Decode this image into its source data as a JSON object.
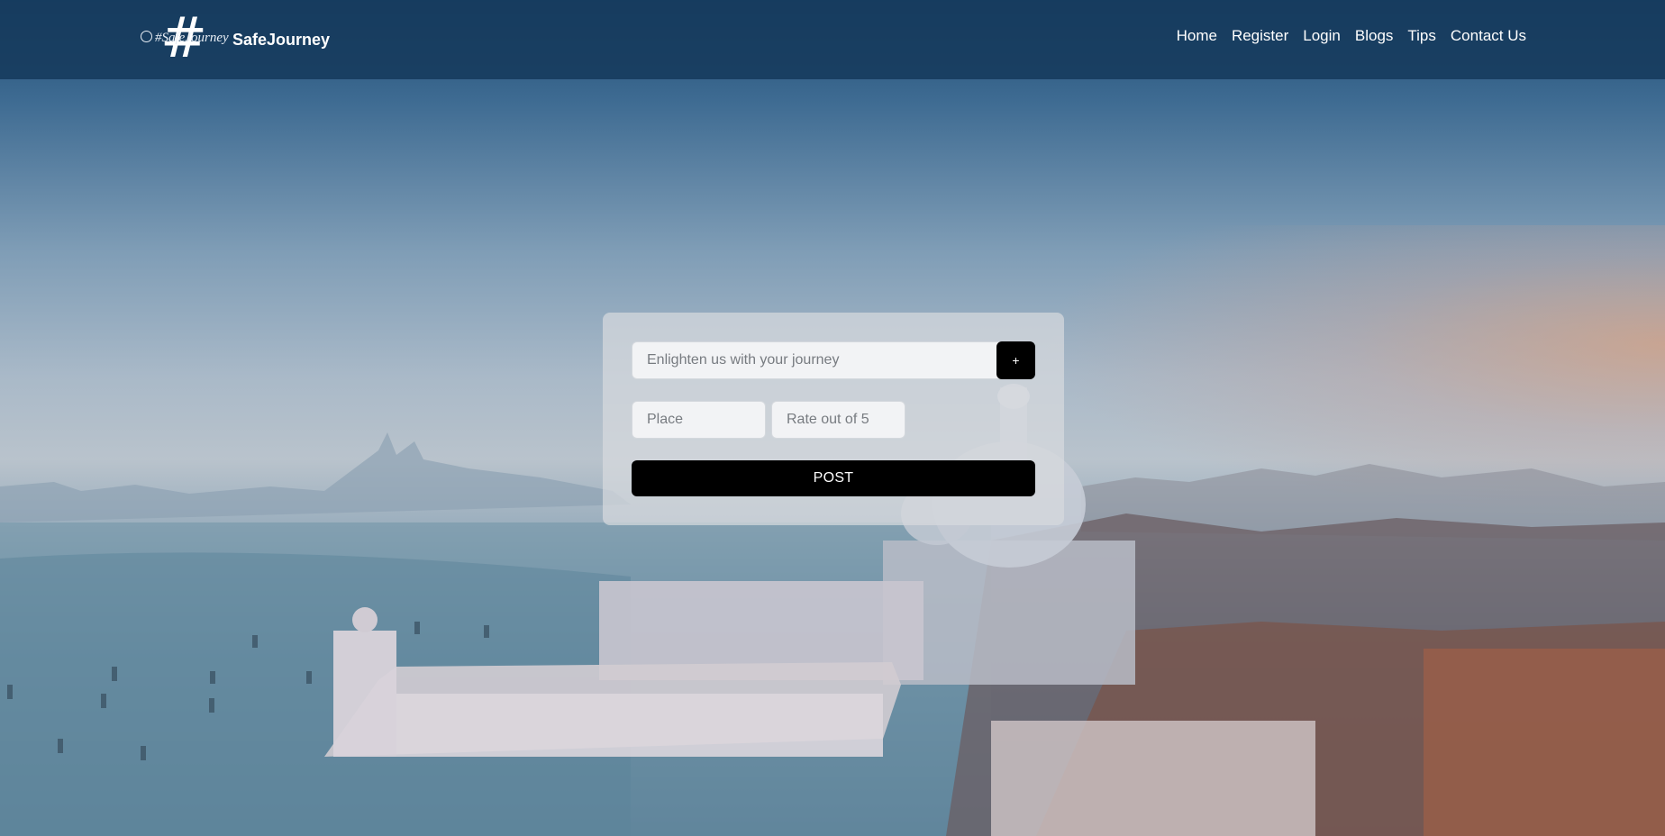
{
  "colors": {
    "navbar_bg": "#163a5c",
    "button_bg": "#000000",
    "button_text": "#ffffff",
    "input_bg": "#f2f3f5",
    "card_bg": "#d7dade"
  },
  "header": {
    "logo_text": "#SafeJourney",
    "logo_icon": "hashtag-globe-logo",
    "brand_name": "SafeJourney",
    "nav": [
      {
        "label": "Home"
      },
      {
        "label": "Register"
      },
      {
        "label": "Login"
      },
      {
        "label": "Blogs"
      },
      {
        "label": "Tips"
      },
      {
        "label": "Contact Us"
      }
    ]
  },
  "form": {
    "journey": {
      "placeholder": "Enlighten us with your journey",
      "value": ""
    },
    "add_label": "+",
    "place": {
      "placeholder": "Place",
      "value": ""
    },
    "rate": {
      "placeholder": "Rate out of 5",
      "value": ""
    },
    "post_label": "POST"
  },
  "background": {
    "description_icon": "venice-cityscape-image"
  }
}
